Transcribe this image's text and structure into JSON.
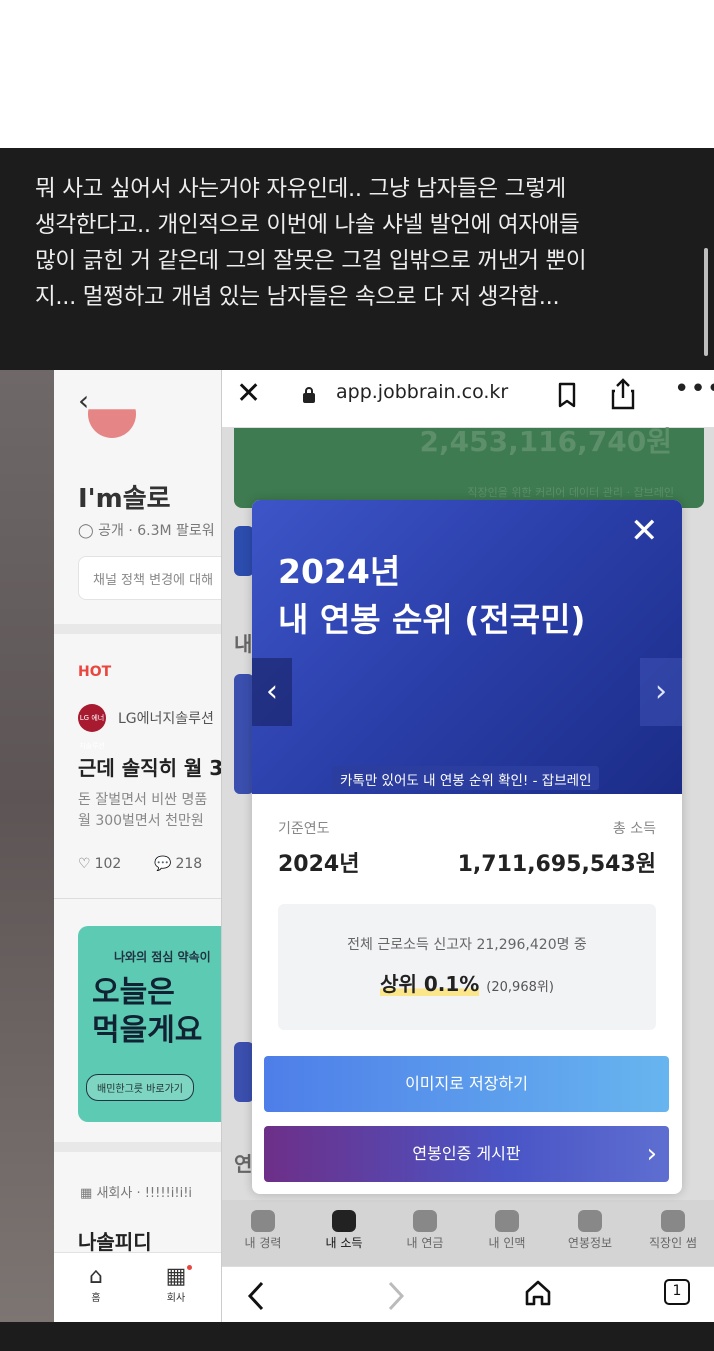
{
  "caption": {
    "text": "뭐 사고 싶어서 사는거야 자유인데.. 그냥 남자들은 그렇게\n생각한다고.. 개인적으로 이번에 나솔 샤넬 발언에 여자애들\n많이 긁힌 거 같은데 그의 잘못은 그걸 입밖으로 꺼낸거 뿐이\n지... 멀쩡하고 개념 있는 남자들은 속으로 다 저 생각함..."
  },
  "blind": {
    "channel_title": "I'm솔로",
    "channel_meta": "공개 · 6.3M 팔로워",
    "notice": "채널 정책 변경에 대해",
    "hot_label": "HOT",
    "company_name": "LG에너지솔루션",
    "company_logo": "LG 에너지솔루션",
    "post_title": "근데 솔직히 월 3",
    "post_body": "돈 잘벌면서 비싼 명품\n월 300벌면서 천만원",
    "likes": "102",
    "comments": "218",
    "ad_top": "나와의 점심 약속이",
    "ad_main": "오늘은 \n먹을게요",
    "ad_button": "배민한그릇 바로가기",
    "post2_meta": "새회사 · !!!!!i!i!i",
    "post2_title": "나솔피디",
    "tab_home": "홈",
    "tab_company": "회사"
  },
  "browser": {
    "url": "app.jobbrain.co.kr",
    "bg_amount": "2,453,116,740원",
    "bg_sub": "직장인을 위한 커리어 데이터 관리 · 잡브레인",
    "bg_left1": "내",
    "bg_left2": "연",
    "bottom_nav": [
      "내 경력",
      "내 소득",
      "내 연금",
      "내 인맥",
      "연봉정보",
      "직장인 썸"
    ],
    "tab_count": "1"
  },
  "modal": {
    "title": "2024년\n내 연봉 순위 (전국민)",
    "tag": "카톡만 있어도 내 연봉 순위 확인! - 잡브레인",
    "year_label": "기준연도",
    "year_value": "2024년",
    "income_label": "총 소득",
    "income_value": "1,711,695,543원",
    "rank_desc": "전체 근로소득 신고자 21,296,420명 중",
    "rank_top": "상위 0.1%",
    "rank_position": "(20,968위)",
    "save_button": "이미지로 저장하기",
    "board_button": "연봉인증 게시판"
  },
  "colors": {
    "modal_header": "#2a3ea8",
    "save_button": "#4e7ee9",
    "board_button": "#6d2f88",
    "hot": "#e8463f"
  }
}
